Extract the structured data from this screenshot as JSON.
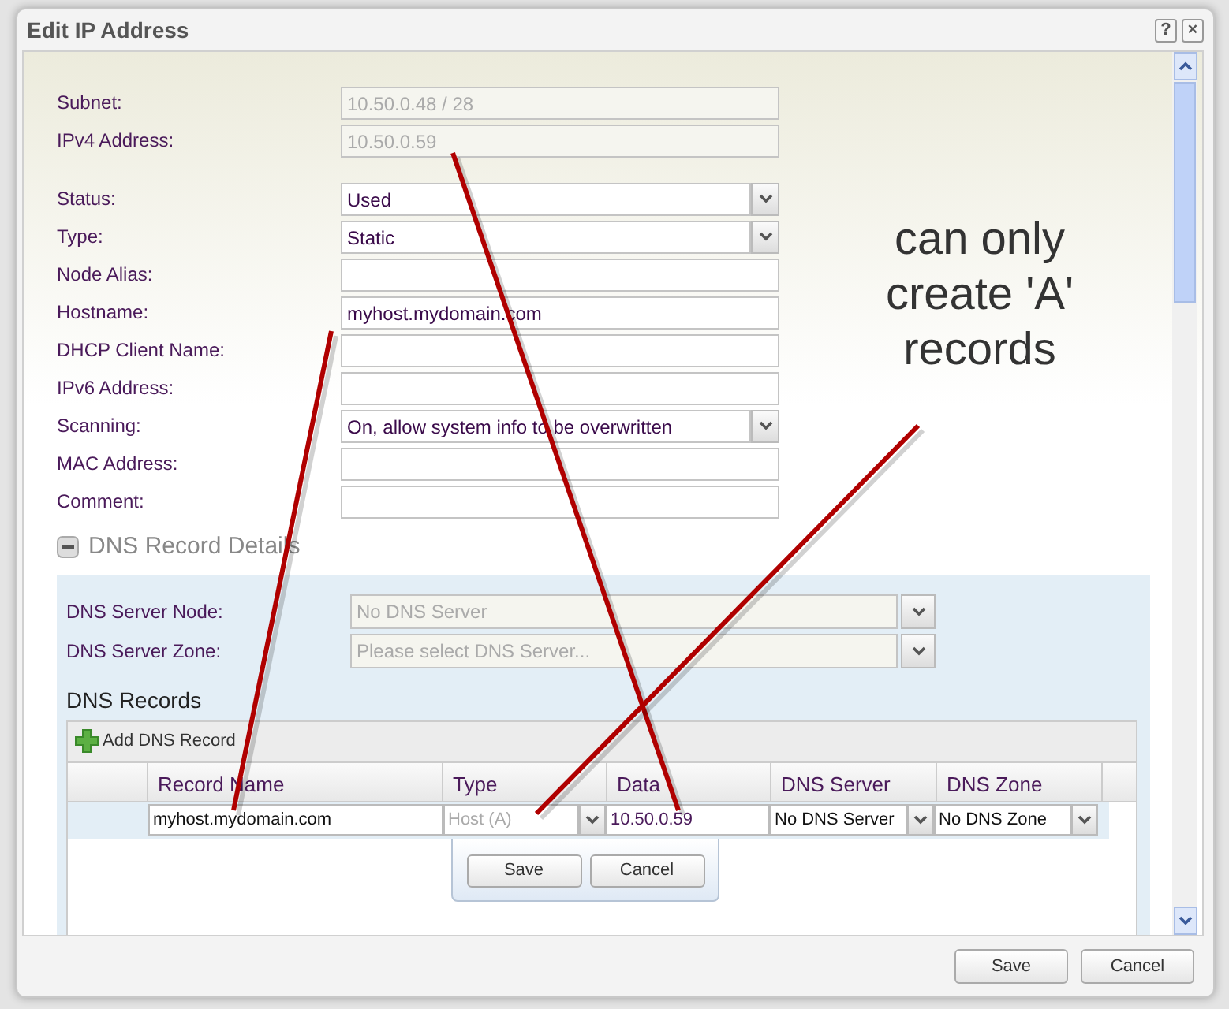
{
  "window": {
    "title": "Edit IP Address",
    "help": "?",
    "close": "×"
  },
  "field_groups": [
    [
      {
        "label": "Subnet:",
        "value": "10.50.0.48 / 28",
        "kind": "text",
        "disabled": true
      },
      {
        "label": "IPv4 Address:",
        "value": "10.50.0.59",
        "kind": "text",
        "disabled": true
      }
    ],
    [
      {
        "label": "Status:",
        "value": "Used",
        "kind": "select",
        "disabled": false
      },
      {
        "label": "Type:",
        "value": "Static",
        "kind": "select",
        "disabled": false
      },
      {
        "label": "Node Alias:",
        "kind": "text",
        "disabled": false
      },
      {
        "label": "Hostname:",
        "value": "myhost.mydomain.com",
        "kind": "text",
        "disabled": false
      },
      {
        "label": "DHCP Client Name:",
        "kind": "text",
        "disabled": false
      },
      {
        "label": "IPv6 Address:",
        "kind": "text",
        "disabled": false
      },
      {
        "label": "Scanning:",
        "value": "On, allow system info to be overwritten",
        "kind": "select",
        "disabled": false
      },
      {
        "label": "MAC Address:",
        "kind": "text",
        "disabled": false
      },
      {
        "label": "Comment:",
        "kind": "text",
        "disabled": false
      }
    ]
  ],
  "dns": {
    "title": "DNS Record Details",
    "expanded": true,
    "server_fields": [
      {
        "label": "DNS Server Node:",
        "placeholder": "No DNS Server",
        "disabled": true
      },
      {
        "label": "DNS Server Zone:",
        "placeholder": "Please select DNS Server...",
        "disabled": true
      }
    ],
    "records_title": "DNS Records",
    "add_button": "Add DNS Record",
    "columns": [
      "Record Name",
      "Type",
      "Data",
      "DNS Server",
      "DNS Zone"
    ],
    "rows": [
      {
        "cells": [
          {
            "value": "myhost.mydomain.com",
            "kind": "text",
            "disabled": false
          },
          {
            "value": "Host (A)",
            "kind": "select",
            "disabled": true
          },
          {
            "value": "10.50.0.59",
            "kind": "text",
            "disabled": false
          },
          {
            "value": "No DNS Server",
            "kind": "select",
            "disabled": false
          },
          {
            "value": "No DNS Zone",
            "kind": "select",
            "disabled": false
          }
        ]
      }
    ],
    "editor_buttons": [
      "Save",
      "Cancel"
    ]
  },
  "footer_buttons": [
    "Save",
    "Cancel"
  ],
  "annotation": {
    "lines": [
      "can only",
      "create 'A'",
      "records"
    ]
  }
}
